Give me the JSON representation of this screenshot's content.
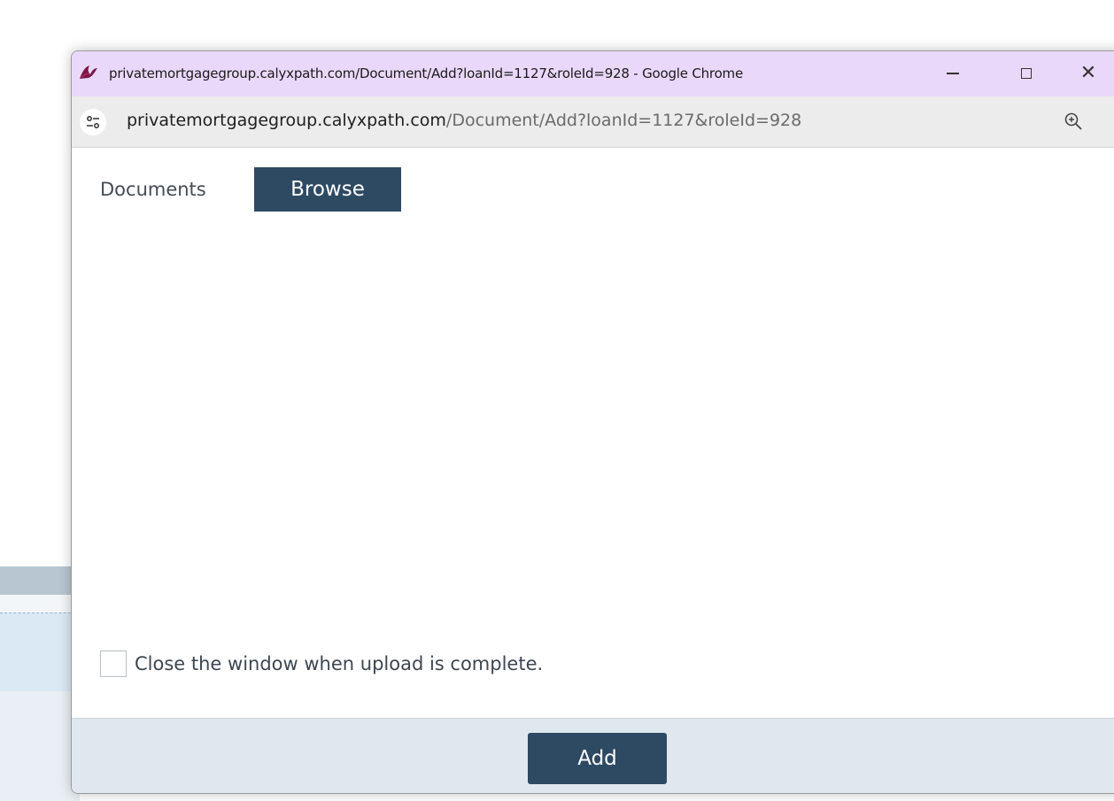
{
  "window": {
    "title": "privatemortgagegroup.calyxpath.com/Document/Add?loanId=1127&roleId=928 - Google Chrome",
    "app_icon": "calyx-path-logo-icon",
    "controls": {
      "minimize_icon": "minimize-icon",
      "maximize_icon": "maximize-icon",
      "close_glyph": "✕"
    }
  },
  "address_bar": {
    "site_info_icon": "tune-icon",
    "url_domain": "privatemortgagegroup.calyxpath.com",
    "url_path": "/Document/Add?loanId=1127&roleId=928",
    "zoom_icon": "zoom-in-icon"
  },
  "content": {
    "documents_label": "Documents",
    "browse_button": "Browse",
    "close_checkbox_checked": false,
    "close_checkbox_label": "Close the window when upload is complete."
  },
  "footer": {
    "add_button": "Add"
  },
  "colors": {
    "titlebar": "#ead8fa",
    "button": "#2e4a63",
    "footer": "#dfe8ef"
  }
}
